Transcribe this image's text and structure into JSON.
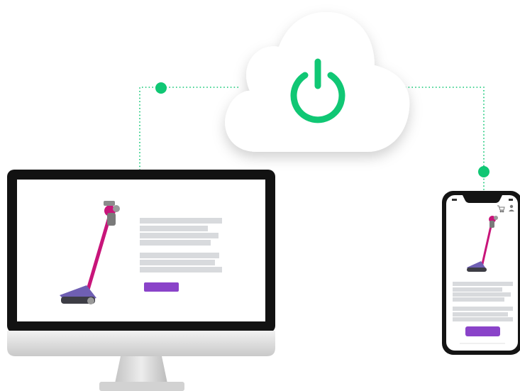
{
  "colors": {
    "accent_green": "#10c774",
    "button_purple": "#8a43c9",
    "placeholder_gray": "#d8dadd",
    "vacuum_magenta": "#c8157a",
    "vacuum_purple": "#6f5fb3"
  },
  "icons": {
    "cloud": "power-icon",
    "phone_header": [
      "cart-icon",
      "user-icon"
    ],
    "device_button": "button-placeholder"
  }
}
